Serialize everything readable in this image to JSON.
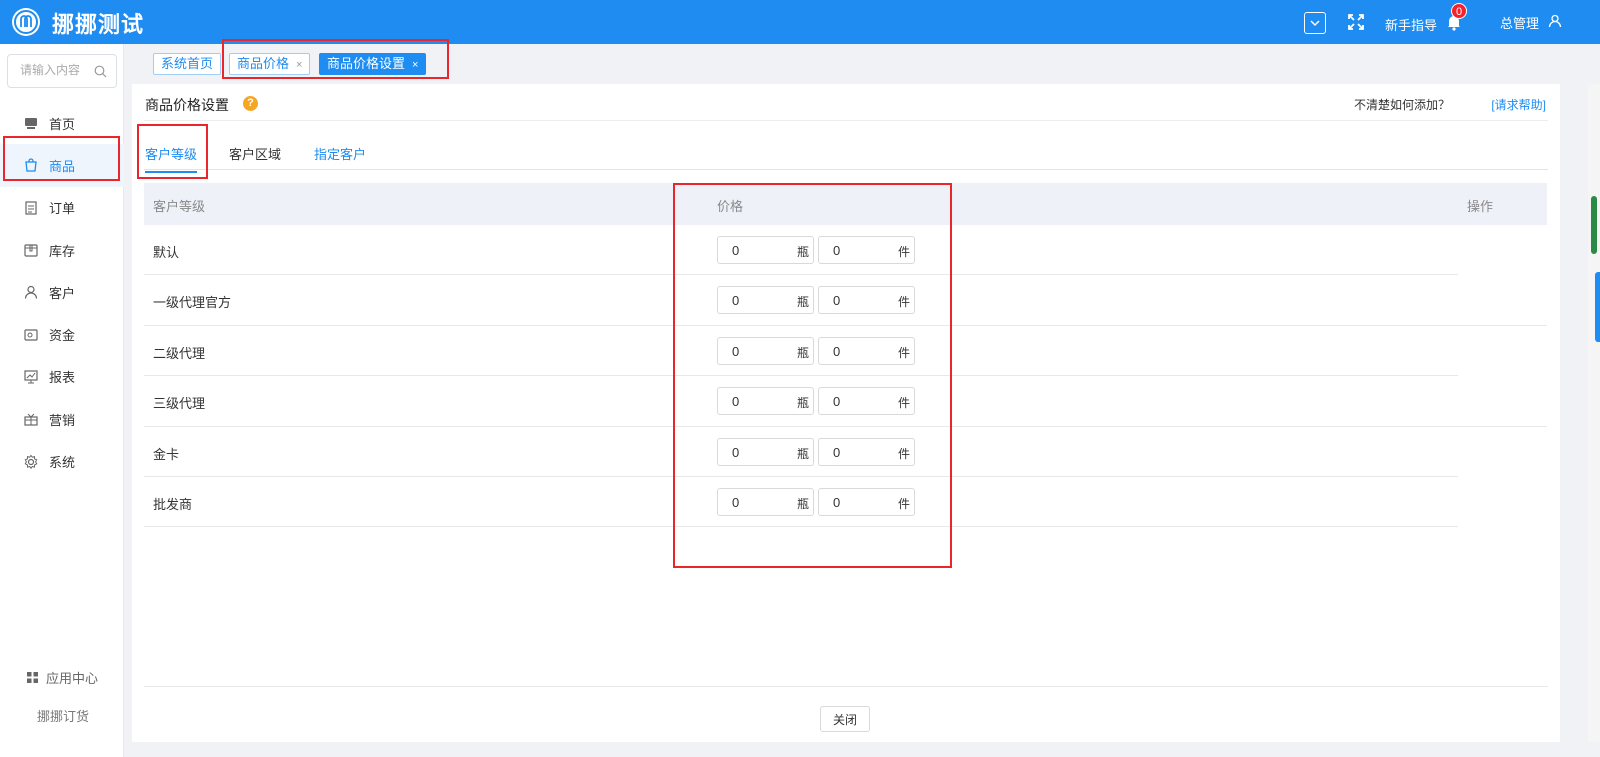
{
  "header": {
    "brand": "挪挪测试",
    "guide_label": "新手指导",
    "notification_count": "0",
    "user_label": "总管理"
  },
  "sidebar": {
    "search_placeholder": "请输入内容",
    "items": [
      {
        "label": "首页",
        "icon": "home-icon"
      },
      {
        "label": "商品",
        "icon": "shopping-bag-icon",
        "active": true
      },
      {
        "label": "订单",
        "icon": "document-icon"
      },
      {
        "label": "库存",
        "icon": "box-icon"
      },
      {
        "label": "客户",
        "icon": "user-icon"
      },
      {
        "label": "资金",
        "icon": "wallet-icon"
      },
      {
        "label": "报表",
        "icon": "report-icon"
      },
      {
        "label": "营销",
        "icon": "gift-icon"
      },
      {
        "label": "系统",
        "icon": "gear-icon"
      }
    ],
    "app_center": "应用中心",
    "footer": "挪挪订货"
  },
  "page_tabs": [
    {
      "label": "系统首页"
    },
    {
      "label": "商品价格",
      "close": "×"
    },
    {
      "label": "商品价格设置",
      "close": "×"
    }
  ],
  "panel": {
    "title": "商品价格设置",
    "help_mark": "?",
    "hint": "不清楚如何添加？",
    "help_link": "[请求帮助]"
  },
  "content_tabs": [
    {
      "label": "客户等级"
    },
    {
      "label": "客户区域"
    },
    {
      "label": "指定客户"
    }
  ],
  "table": {
    "headers": {
      "level": "客户等级",
      "price": "价格",
      "action": "操作"
    },
    "rows": [
      {
        "name": "默认",
        "price_bottle": "0",
        "unit_bottle": "瓶",
        "price_piece": "0",
        "unit_piece": "件"
      },
      {
        "name": "一级代理官方",
        "price_bottle": "0",
        "unit_bottle": "瓶",
        "price_piece": "0",
        "unit_piece": "件"
      },
      {
        "name": "二级代理",
        "price_bottle": "0",
        "unit_bottle": "瓶",
        "price_piece": "0",
        "unit_piece": "件"
      },
      {
        "name": "三级代理",
        "price_bottle": "0",
        "unit_bottle": "瓶",
        "price_piece": "0",
        "unit_piece": "件"
      },
      {
        "name": "金卡",
        "price_bottle": "0",
        "unit_bottle": "瓶",
        "price_piece": "0",
        "unit_piece": "件"
      },
      {
        "name": "批发商",
        "price_bottle": "0",
        "unit_bottle": "瓶",
        "price_piece": "0",
        "unit_piece": "件"
      }
    ]
  },
  "footer": {
    "close_label": "关闭"
  },
  "colors": {
    "primary": "#1e8cf0",
    "annotation": "#e8262b",
    "help": "#f5a623",
    "badge": "#f5222d"
  }
}
